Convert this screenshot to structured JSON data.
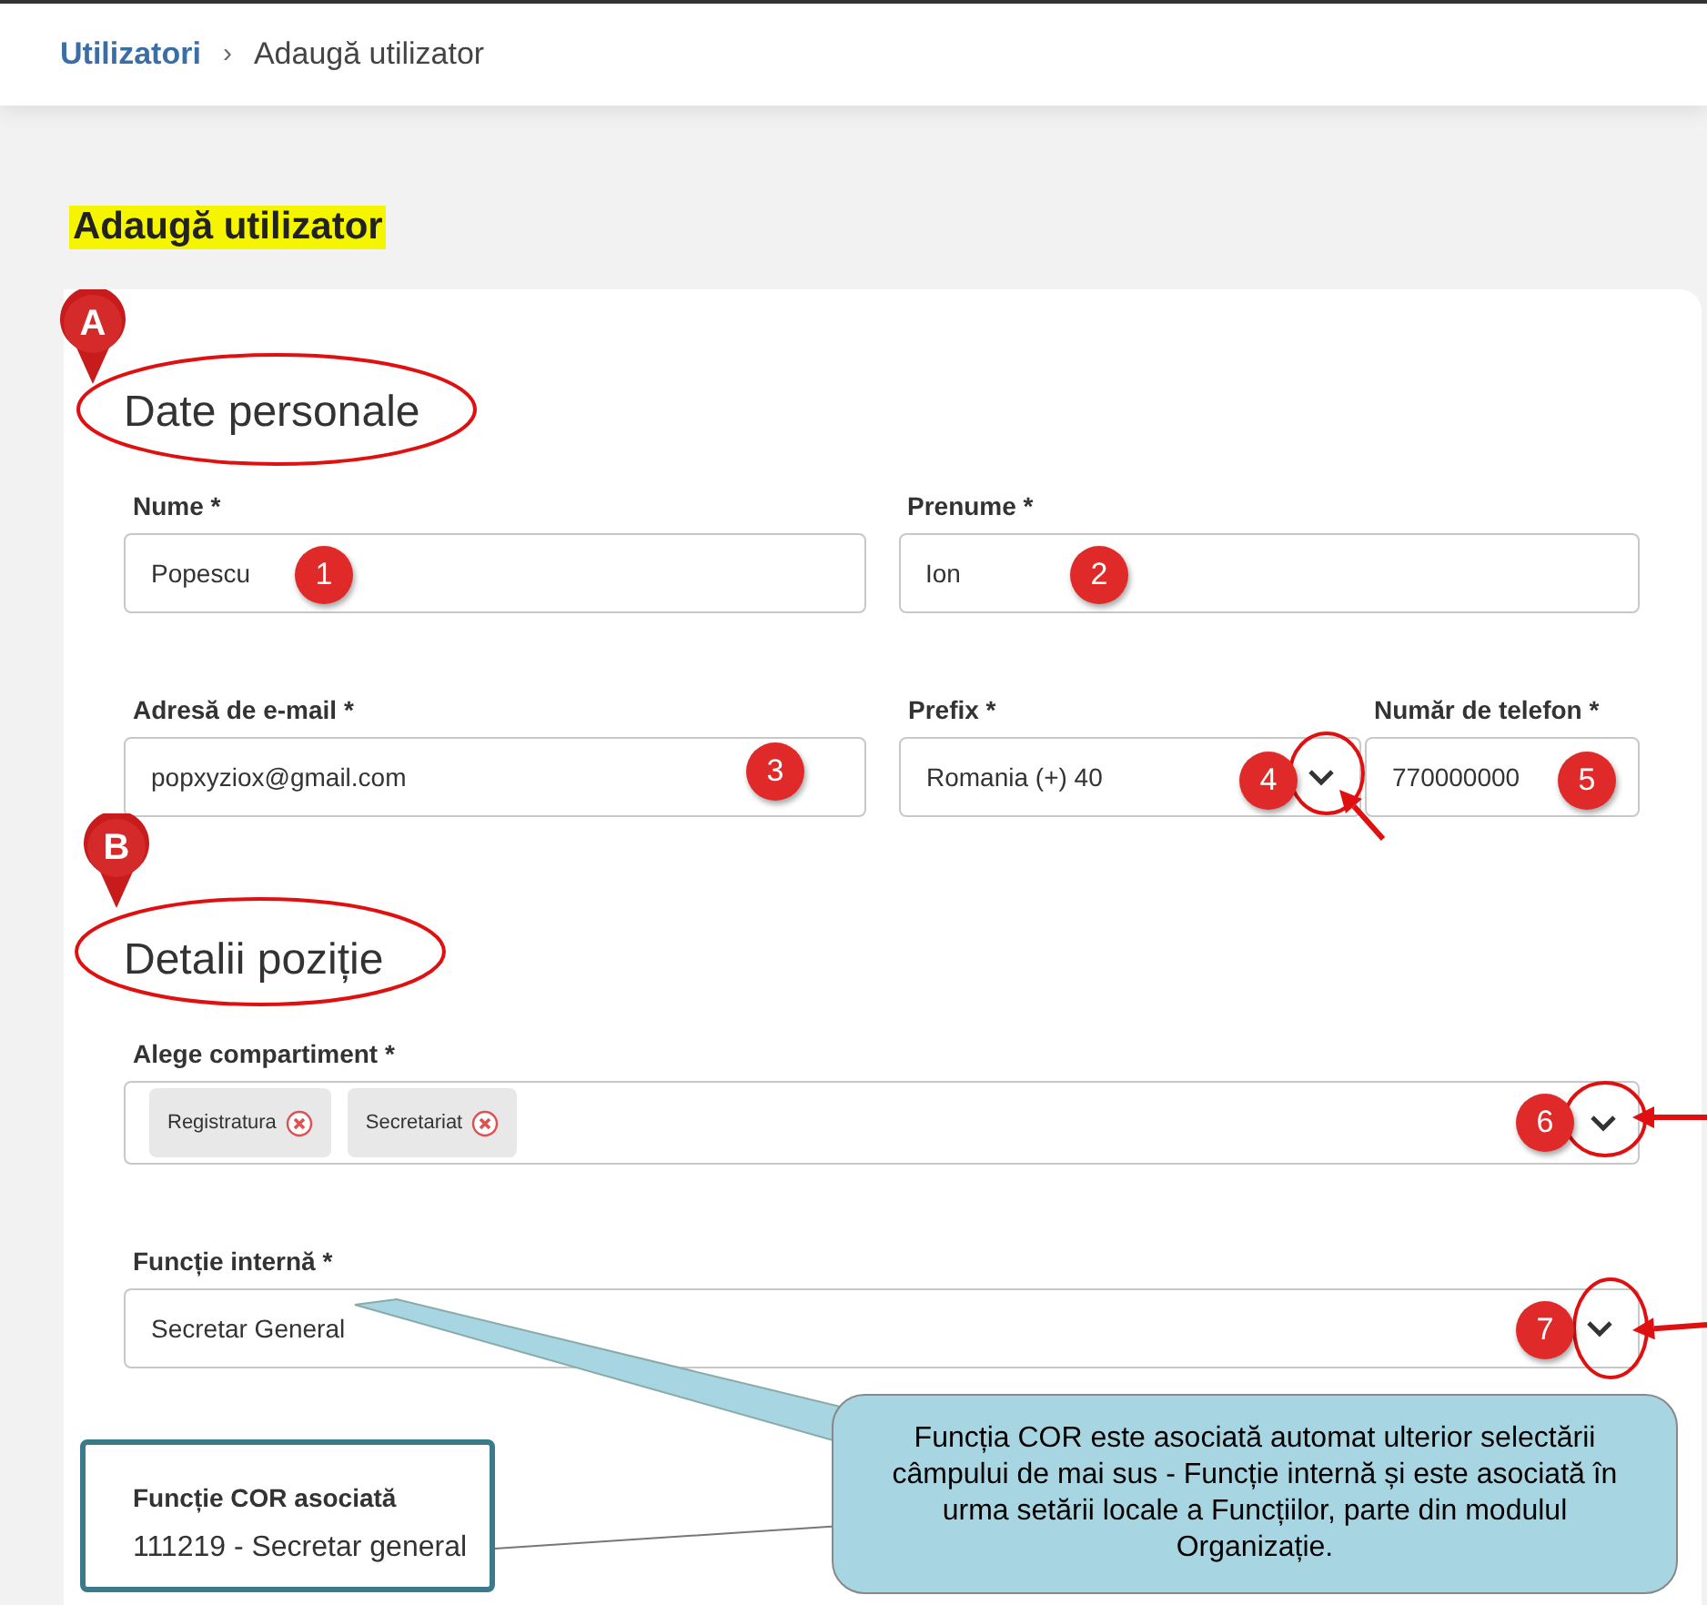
{
  "breadcrumb": [
    {
      "label": "Utilizatori",
      "kind": "link"
    },
    {
      "label": "Adaugă utilizator",
      "kind": "current"
    }
  ],
  "breadcrumb_separator": "›",
  "page_title": "Adaugă utilizator",
  "sections": [
    {
      "title": "Date personale",
      "rows": [
        {
          "fields": [
            {
              "kind": "text",
              "label": "Nume *",
              "value": "Popescu"
            },
            {
              "kind": "text",
              "label": "Prenume *",
              "value": "Ion"
            }
          ]
        },
        {
          "fields": [
            {
              "kind": "text",
              "label": "Adresă de e-mail *",
              "value": "popxyziox@gmail.com"
            },
            {
              "kind": "select",
              "label": "Prefix *",
              "value": "Romania (+) 40"
            },
            {
              "kind": "text",
              "label": "Număr de telefon *",
              "value": "770000000"
            }
          ]
        }
      ]
    },
    {
      "title": "Detalii poziție",
      "rows": [
        {
          "fields": [
            {
              "kind": "multiselect",
              "label": "Alege compartiment *",
              "chips": [
                "Registratura",
                "Secretariat"
              ]
            }
          ]
        },
        {
          "fields": [
            {
              "kind": "select",
              "label": "Funcție internă *",
              "value": "Secretar General"
            }
          ]
        }
      ]
    }
  ],
  "readonly": {
    "label": "Funcție COR asociată",
    "value": "111219 - Secretar general"
  },
  "annotations": {
    "pins": [
      "A",
      "B"
    ],
    "badges": [
      "1",
      "2",
      "3",
      "4",
      "5",
      "6",
      "7"
    ],
    "callout": "Funcția COR este asociată automat ulterior selectării câmpului de mai sus - Funcție internă și este asociată în urma setării locale a Funcțiilor, parte din modulul Organizație."
  }
}
